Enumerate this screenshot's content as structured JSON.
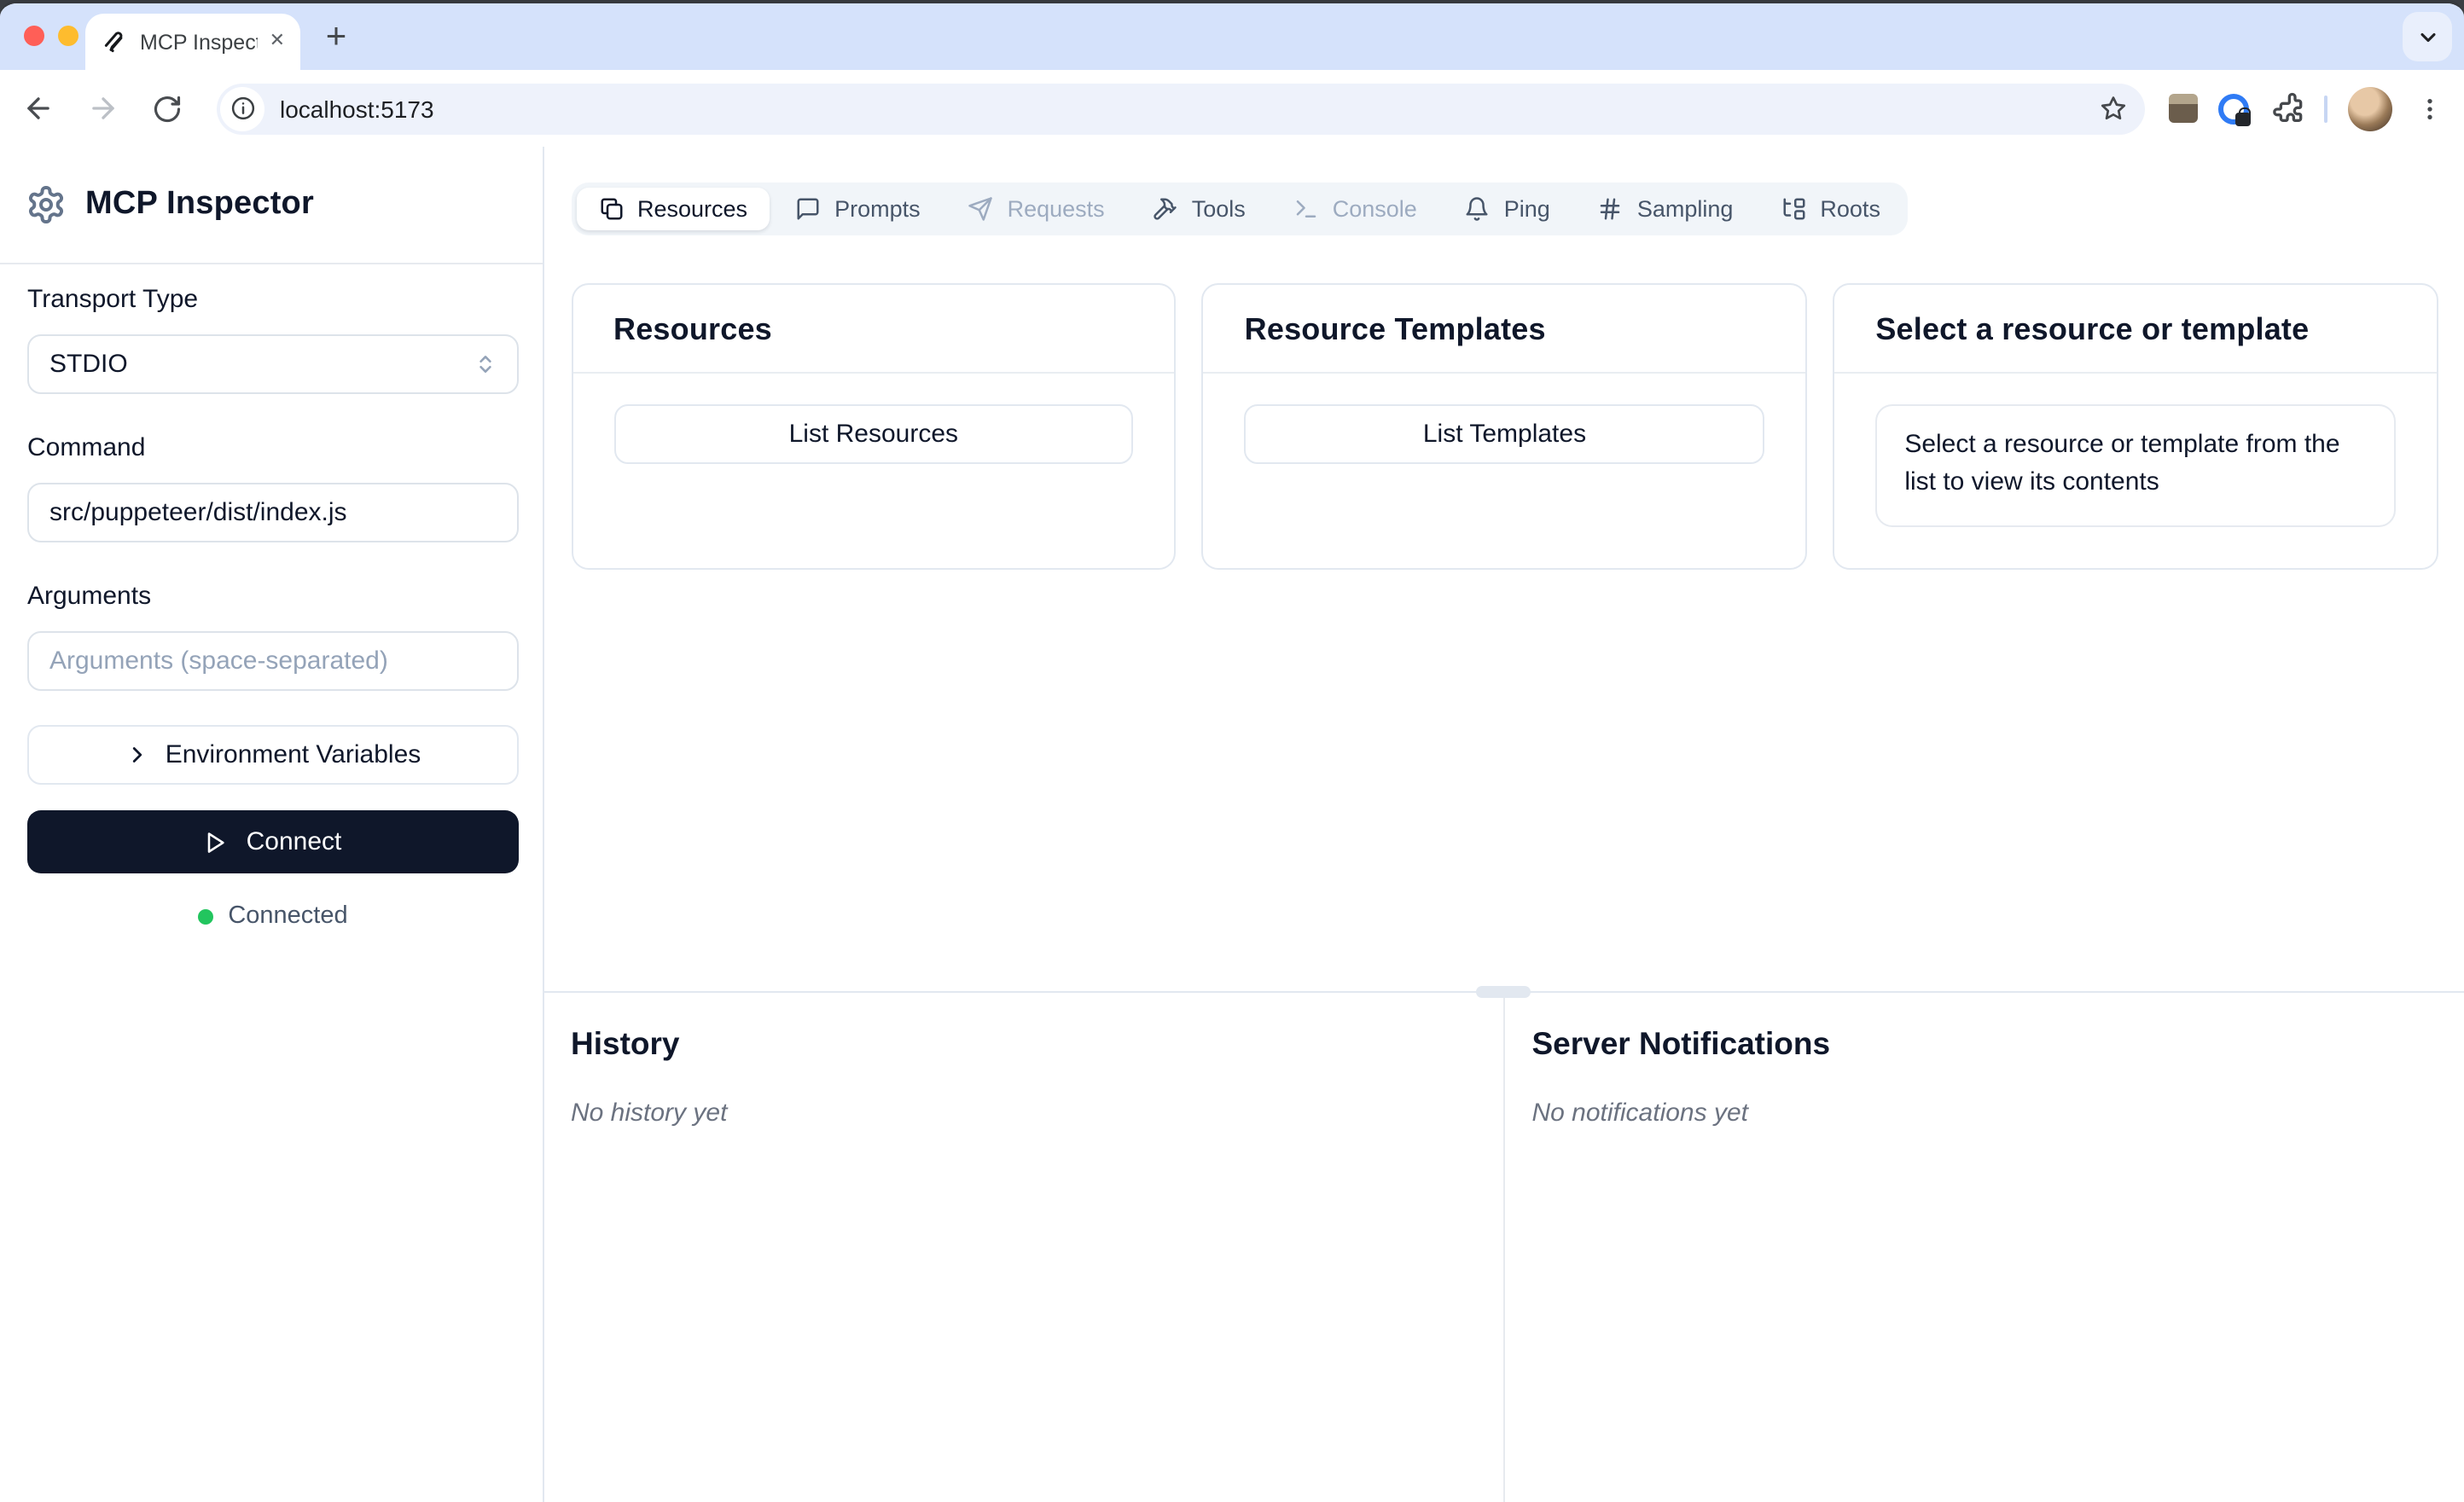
{
  "browser": {
    "tab_title": "MCP Inspector",
    "close_tab_glyph": "✕",
    "new_tab_glyph": "+",
    "url": "localhost:5173"
  },
  "sidebar": {
    "title": "MCP Inspector",
    "transport_label": "Transport Type",
    "transport_value": "STDIO",
    "command_label": "Command",
    "command_value": "src/puppeteer/dist/index.js",
    "arguments_label": "Arguments",
    "arguments_placeholder": "Arguments (space-separated)",
    "env_button_label": "Environment Variables",
    "connect_button_label": "Connect",
    "status_text": "Connected"
  },
  "tabs": [
    {
      "label": "Resources",
      "icon": "files-icon",
      "state": "active"
    },
    {
      "label": "Prompts",
      "icon": "message-square-icon",
      "state": "enabled"
    },
    {
      "label": "Requests",
      "icon": "send-icon",
      "state": "disabled"
    },
    {
      "label": "Tools",
      "icon": "hammer-icon",
      "state": "enabled"
    },
    {
      "label": "Console",
      "icon": "terminal-icon",
      "state": "disabled"
    },
    {
      "label": "Ping",
      "icon": "bell-icon",
      "state": "enabled"
    },
    {
      "label": "Sampling",
      "icon": "hash-icon",
      "state": "enabled"
    },
    {
      "label": "Roots",
      "icon": "folder-tree-icon",
      "state": "enabled"
    }
  ],
  "cards": {
    "resources": {
      "title": "Resources",
      "button_label": "List Resources"
    },
    "templates": {
      "title": "Resource Templates",
      "button_label": "List Templates"
    },
    "preview": {
      "title": "Select a resource or template",
      "body": "Select a resource or template from the list to view its contents"
    }
  },
  "bottom": {
    "history_title": "History",
    "history_empty": "No history yet",
    "notifications_title": "Server Notifications",
    "notifications_empty": "No notifications yet"
  },
  "colors": {
    "accent_dark": "#0f172a",
    "status_green": "#22c55e",
    "tabstrip_blue": "#d5e2fb",
    "omnibox_blue": "#eef2fb",
    "border": "#e2e8f0",
    "muted_text": "#6b7280",
    "traffic_close": "#ff5f57",
    "traffic_min": "#febc2e",
    "traffic_max": "#28c840"
  }
}
